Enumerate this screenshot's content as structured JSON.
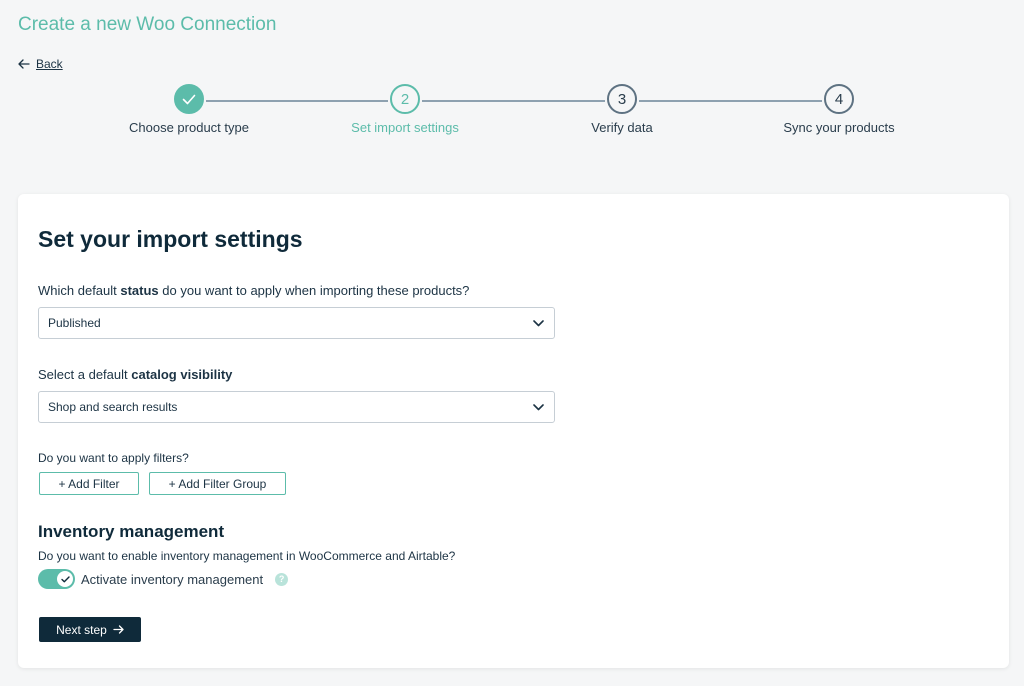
{
  "page": {
    "title": "Create a new Woo Connection",
    "back_label": "Back"
  },
  "stepper": {
    "steps": [
      {
        "number": "1",
        "label": "Choose product type",
        "state": "done"
      },
      {
        "number": "2",
        "label": "Set import settings",
        "state": "active"
      },
      {
        "number": "3",
        "label": "Verify data",
        "state": "todo"
      },
      {
        "number": "4",
        "label": "Sync your products",
        "state": "todo"
      }
    ]
  },
  "form": {
    "title": "Set your import settings",
    "status": {
      "label_prefix": "Which default ",
      "label_bold": "status",
      "label_suffix": " do you want to apply when importing these products?",
      "value": "Published"
    },
    "visibility": {
      "label_prefix": "Select a default ",
      "label_bold": "catalog visibility",
      "value": "Shop and search results"
    },
    "filters": {
      "question": "Do you want to apply filters?",
      "add_filter_label": "+ Add Filter",
      "add_filter_group_label": "+ Add Filter Group"
    },
    "inventory": {
      "title": "Inventory management",
      "question": "Do you want to enable inventory management in WooCommerce and Airtable?",
      "toggle_label": "Activate inventory management",
      "toggle_on": true,
      "help_glyph": "?"
    },
    "next_label": "Next step"
  },
  "colors": {
    "accent": "#5cbcaa",
    "dark": "#0f2a3a",
    "background": "#f5f6f7"
  },
  "icons": {
    "back": "arrow-left-icon",
    "done_step": "check-icon",
    "select": "chevron-down-icon",
    "toggle": "check-icon",
    "help": "question-icon",
    "next": "arrow-right-icon"
  }
}
